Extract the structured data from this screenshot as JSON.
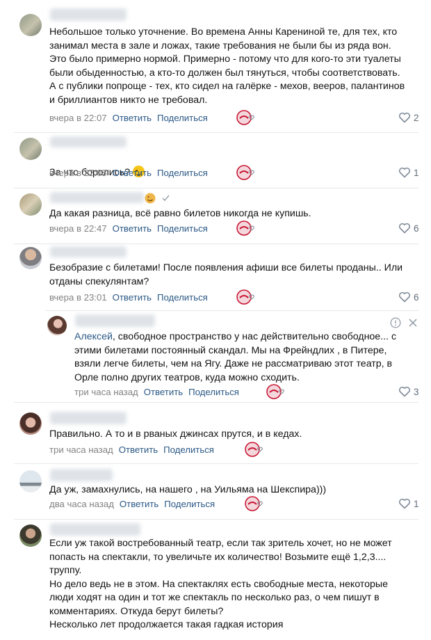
{
  "labels": {
    "reply": "Ответить",
    "share": "Поделиться"
  },
  "comments": [
    {
      "text": "Небольшое только уточнение. Во времена Анны Карениной те, для тех, кто\nзанимал места в зале и ложах, такие требования не были бы из ряда вон.\nЭто было примерно нормой. Примерно - потому что для кого-то эти туалеты\nбыли обыденностью, а кто-то должен был тянуться, чтобы соответствовать.\nА с публики попроще - тех, кто сидел на галёрке - мехов, вееров, палантинов\nи бриллиантов никто не требовал.",
      "time": "вчера в 22:07",
      "likes": "2"
    },
    {
      "text": "За что боролись?",
      "time": "вчера в 22:08",
      "likes": "1"
    },
    {
      "text": "Да какая разница, всё равно билетов никогда не купишь.",
      "time": "вчера в 22:47",
      "likes": "6"
    },
    {
      "text": "Безобразие с билетами! После появления афиши все билеты проданы.. Или\nотданы спекулянтам?",
      "time": "вчера в 23:01",
      "likes": "6"
    },
    {
      "reply_to": "Алексей",
      "text": ", свободное пространство у нас действительно свободное... с\nэтими билетами постоянный скандал. Мы на Фрейндлих , в Питере,\nвзяли легче билеты, чем на Ягу. Даже не рассматриваю этот театр, в\nОрле полно других театров, куда можно сходить.",
      "time": "три часа назад",
      "likes": "3"
    },
    {
      "text": "Правильно. А то и в рваных джинсах прутся, и в кедах.",
      "time": "три часа назад",
      "likes": ""
    },
    {
      "text": "Да уж, замахнулись, на нашего , на Уильяма на Шекспира)))",
      "time": "два часа назад",
      "likes": "1"
    },
    {
      "text": "Если уж такой востребованный театр, если так зритель хочет, но не может\nпопасть на спектакли, то увеличьте их количество! Возьмите ещё 1,2,3....\nтруппу.\nНо дело ведь не в этом. На спектаклях есть свободные места, некоторые\nлюди ходят на один и тот же спектакль по несколько раз, о чем пишут в\nкомментариях. Откуда берут билеты?\nНесколько лет продолжается такая гадкая история",
      "time": "",
      "likes": ""
    }
  ],
  "colors": {
    "link": "#2a5885",
    "meta": "#828282",
    "badge": "#c8102e"
  },
  "icons": {
    "like": "heart-outline-icon",
    "badge": "heart-badge-icon",
    "report": "report-icon",
    "close": "close-icon",
    "emoji": "wink-emoji-icon",
    "verified": "check-icon"
  }
}
